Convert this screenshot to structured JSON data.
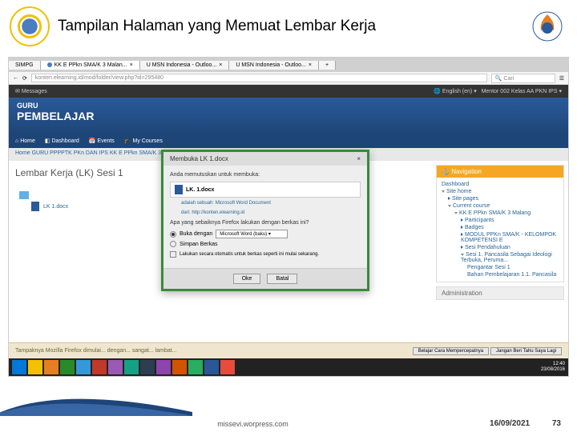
{
  "slide": {
    "title": "Tampilan Halaman yang Memuat Lembar Kerja",
    "credit": "missevi.worpress.com",
    "date": "16/09/2021",
    "page": "73"
  },
  "browser": {
    "tabs": [
      "SIMPG",
      "KK E PPkn SMA/K 3 Malan...",
      "U MSN Indonesia - Outloo...",
      "U MSN Indonesia - Outloo..."
    ],
    "url": "konten.elearning.id/mod/folder/view.php?id=295480",
    "search": "Cari"
  },
  "topbar": {
    "messages": "Messages",
    "lang": "English (en)",
    "user": "Mentor 002 Kelas AA PKN IPS"
  },
  "brand": {
    "line1": "GURU",
    "line2": "PEMBELAJAR"
  },
  "nav": {
    "home": "Home",
    "dashboard": "Dashboard",
    "events": "Events",
    "courses": "My Courses"
  },
  "breadcrumb": "Home   GURU   PPPPTK PKn DAN IPS   KK E PPkn SMA/K 3 Malang                                                                                                          Kerja (LK) Sesi 1",
  "page": {
    "heading": "Lembar Kerja (LK) Sesi 1",
    "file": "LK 1.docx"
  },
  "nav_panel": {
    "title": "Navigation",
    "items": {
      "dashboard": "Dashboard",
      "sitehome": "Site home",
      "sitepages": "Site pages",
      "current": "Current course",
      "course": "KK E PPkn SMA/K 3 Malang",
      "participants": "Participants",
      "badges": "Badges",
      "modul": "MODUL PPKn SMA/K - KELOMPOK KOMPETENSI E",
      "sesi_pend": "Sesi Pendahuluan",
      "sesi1": "Sesi 1. Pancasila Sebagai Ideologi Terbuka, Peruma...",
      "pengantar": "Pengantar Sesi 1",
      "bahan": "Bahan Pembelajaran 1.1. Pancasila"
    }
  },
  "admin_panel": {
    "title": "Administration"
  },
  "dialog": {
    "title": "Membuka LK 1.docx",
    "prompt": "Anda memutuskan untuk membuka:",
    "file": "LK. 1.docx",
    "filetype": "adalah sebuah: Microsoft Word Document",
    "fileloc": "dari: http://konten.elearning.id",
    "question": "Apa yang sebaiknya Firefox lakukan dengan berkas ini?",
    "open_with": "Buka dengan",
    "open_app": "Microsoft Word (baku)",
    "save": "Simpan Berkas",
    "remember": "Lakukan secara otomatis untuk berkas seperti ini mulai sekarang.",
    "ok": "Oke",
    "cancel": "Batal"
  },
  "bottombar": {
    "msg": "Tampaknya Mozilla Firefox dimulai... dengan... sangat... lambat...",
    "btn1": "Belajar Cara Mempercepatnya",
    "btn2": "Jangan Beri Tahu Saya Lagi"
  },
  "taskbar": {
    "time": "12:40",
    "date": "23/08/2016"
  }
}
